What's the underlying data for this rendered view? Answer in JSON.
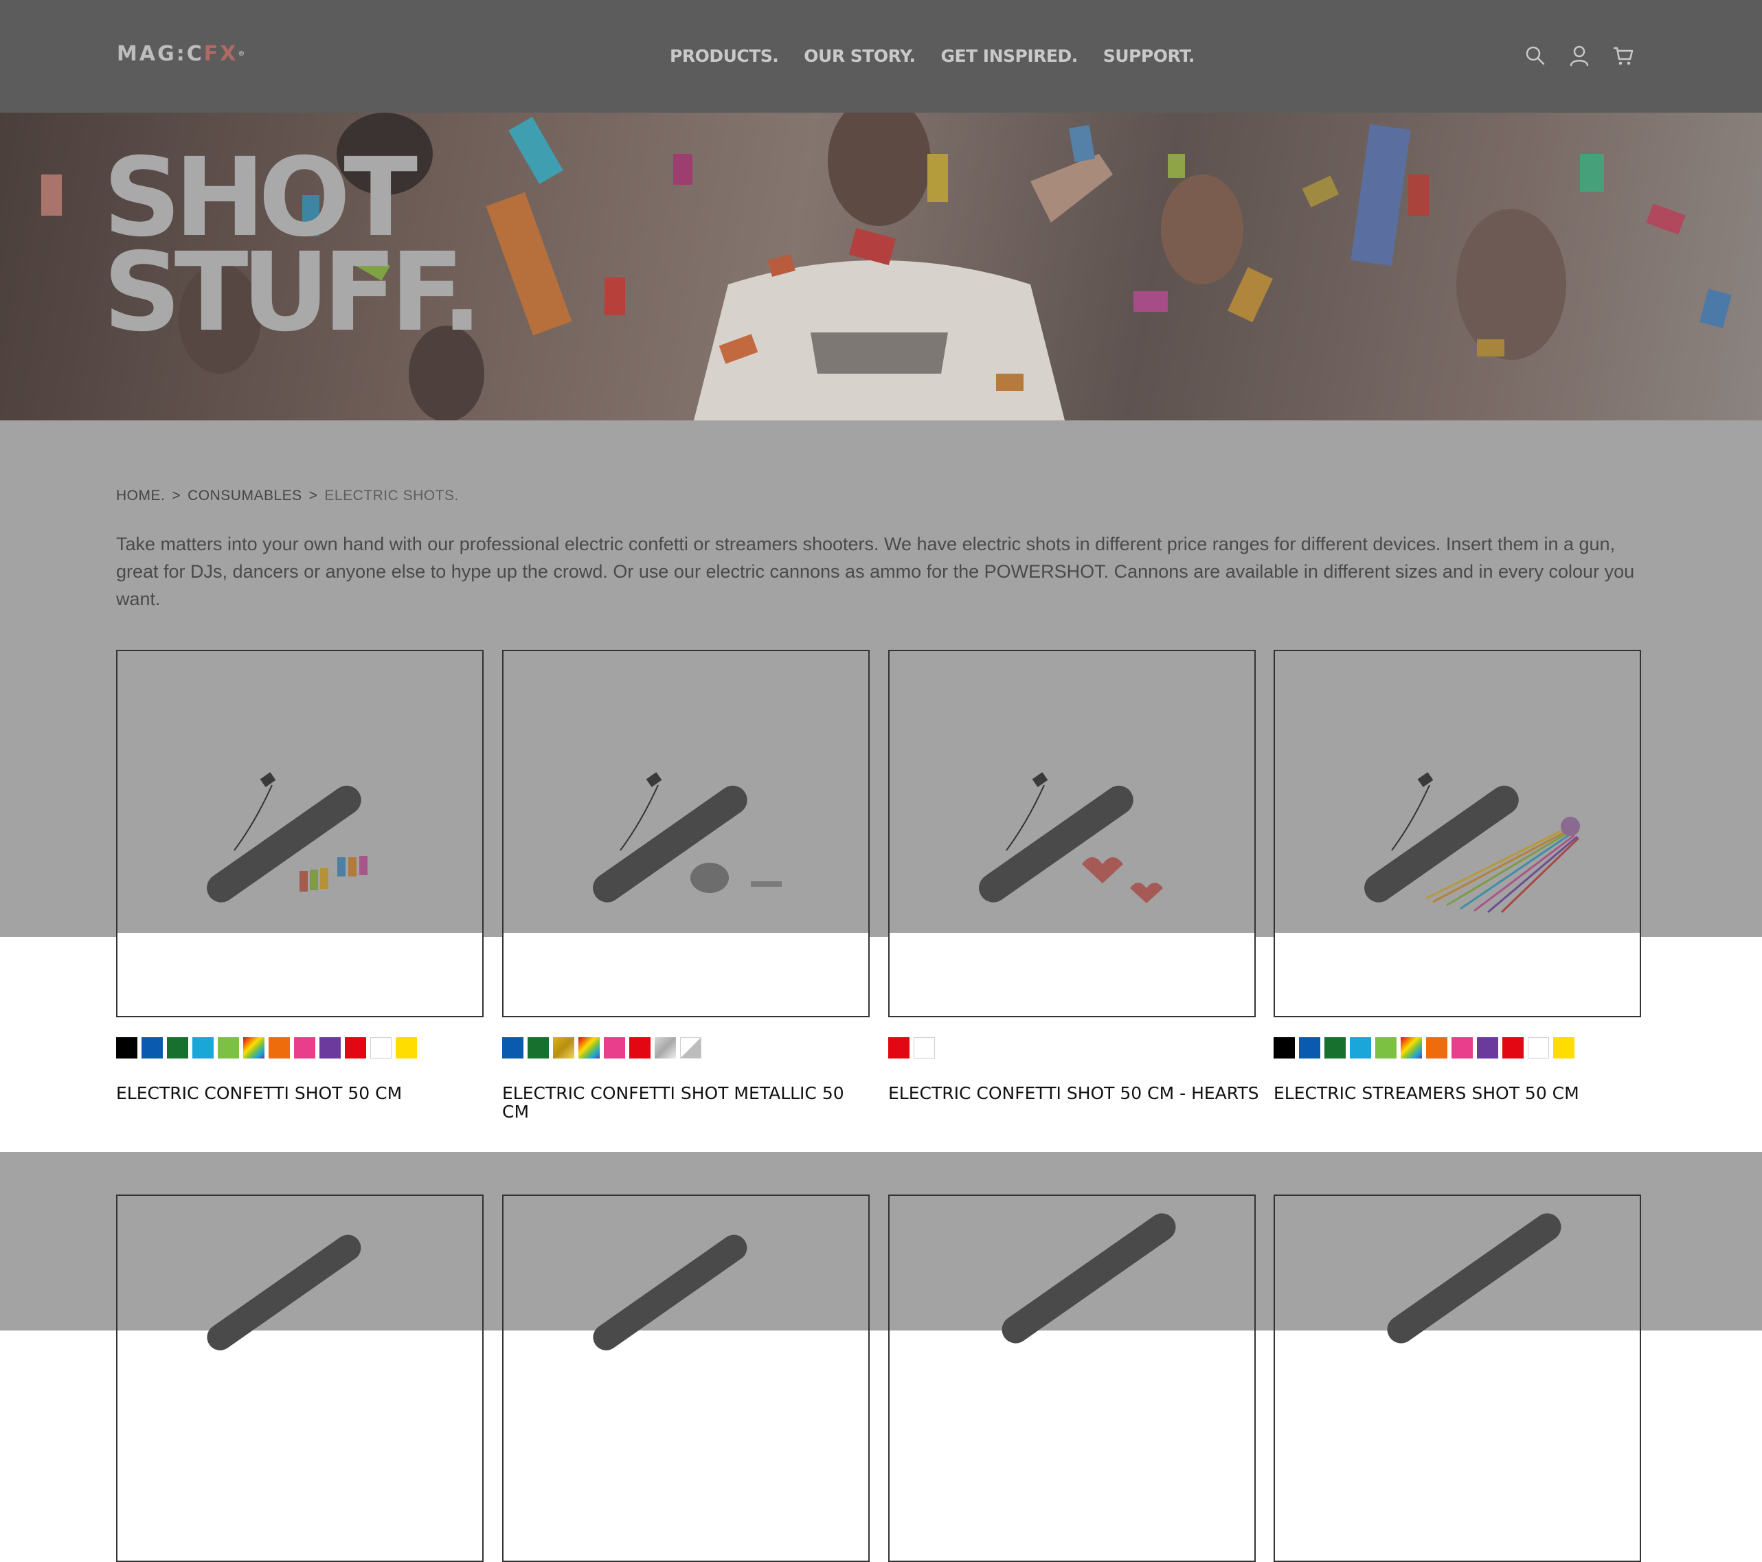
{
  "header": {
    "logo_main": "MAG:C",
    "logo_fx": "FX",
    "logo_mark": "®",
    "nav": [
      "PRODUCTS.",
      "OUR STORY.",
      "GET INSPIRED.",
      "SUPPORT."
    ],
    "icons": [
      "search-icon",
      "account-icon",
      "cart-icon"
    ]
  },
  "hero": {
    "title_line1": "SHOT",
    "title_line2": "STUFF."
  },
  "breadcrumb": {
    "home": "HOME.",
    "sep1": ">",
    "consumables": "CONSUMABLES",
    "sep2": ">",
    "current": "ELECTRIC SHOTS."
  },
  "intro": "Take matters into your own hand with our professional electric confetti or streamers shooters. We have electric shots in different price ranges for different devices. Insert them in a gun, great for DJs, dancers or anyone else to hype up the crowd. Or use our electric cannons as ammo for the POWERSHOT. Cannons are available in different sizes and in every colour you want.",
  "products": [
    {
      "title": "ELECTRIC CONFETTI SHOT 50 CM",
      "swatches": [
        "#000000",
        "#0a5bb0",
        "#17702e",
        "#1aa6d8",
        "#7cc142",
        "rainbow",
        "#ef6c0c",
        "#e83e8c",
        "#6c3a9c",
        "#e30613",
        "#ffffff",
        "#ffdd00"
      ]
    },
    {
      "title": "ELECTRIC CONFETTI SHOT METALLIC 50 CM",
      "swatches": [
        "#0a5bb0",
        "#17702e",
        "gold",
        "rainbow",
        "#e83e8c",
        "#e30613",
        "silver",
        "white-silver"
      ]
    },
    {
      "title": "ELECTRIC CONFETTI SHOT 50 CM - HEARTS",
      "swatches": [
        "#e30613",
        "#ffffff"
      ]
    },
    {
      "title": "ELECTRIC STREAMERS SHOT 50 CM",
      "swatches": [
        "#000000",
        "#0a5bb0",
        "#17702e",
        "#1aa6d8",
        "#7cc142",
        "rainbow",
        "#ef6c0c",
        "#e83e8c",
        "#6c3a9c",
        "#e30613",
        "#ffffff",
        "#ffdd00"
      ]
    }
  ]
}
